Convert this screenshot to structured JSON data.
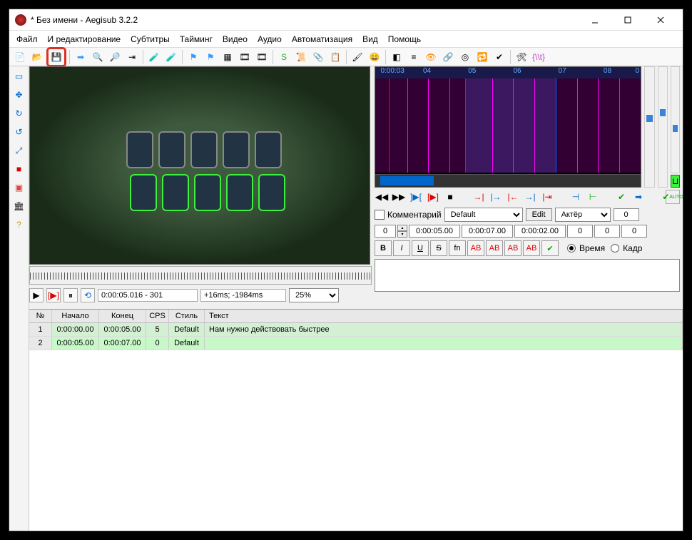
{
  "window": {
    "title": "* Без имени - Aegisub 3.2.2"
  },
  "menu": [
    "Файл",
    "И редактирование",
    "Субтитры",
    "Тайминг",
    "Видео",
    "Аудио",
    "Автоматизация",
    "Вид",
    "Помощь"
  ],
  "waveform_ticks": [
    "0:00:03",
    "04",
    "05",
    "06",
    "07",
    "08",
    "0"
  ],
  "video": {
    "timepos": "0:00:05.016 - 301",
    "offset": "+16ms; -1984ms",
    "zoom": "25%"
  },
  "edit": {
    "comment_label": "Комментарий",
    "style": "Default",
    "edit_btn": "Edit",
    "actor_placeholder": "Актёр",
    "margin_r": "0",
    "layer": "0",
    "start": "0:00:05.00",
    "end": "0:00:07.00",
    "duration": "0:00:02.00",
    "ml": "0",
    "mr": "0",
    "mv": "0",
    "time_label": "Время",
    "frame_label": "Кадр"
  },
  "fmt": {
    "b": "B",
    "i": "I",
    "u": "U",
    "s": "S",
    "fn": "fn",
    "ab1": "AB",
    "ab2": "AB",
    "ab3": "AB",
    "ab4": "AB"
  },
  "grid": {
    "headers": {
      "num": "№",
      "start": "Начало",
      "end": "Конец",
      "cps": "CPS",
      "style": "Стиль",
      "text": "Текст"
    },
    "rows": [
      {
        "num": "1",
        "start": "0:00:00.00",
        "end": "0:00:05.00",
        "cps": "5",
        "style": "Default",
        "text": "Нам нужно действовать быстрее"
      },
      {
        "num": "2",
        "start": "0:00:05.00",
        "end": "0:00:07.00",
        "cps": "0",
        "style": "Default",
        "text": ""
      }
    ]
  }
}
